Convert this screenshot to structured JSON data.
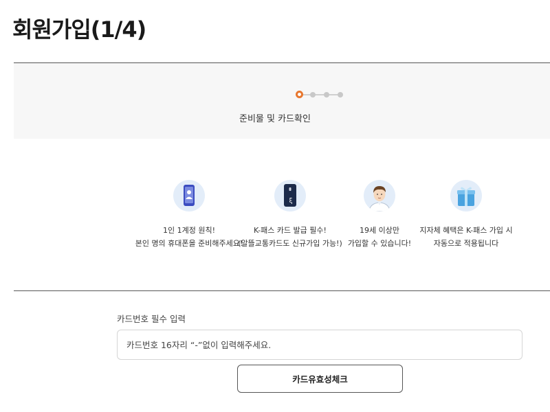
{
  "page": {
    "title": "회원가입(1/4)"
  },
  "stepper": {
    "total_steps": 4,
    "current_step": 1,
    "current_label": "준비물 및 카드확인",
    "accent_color": "#e8772e"
  },
  "features": [
    {
      "icon": "smartphone-user-icon",
      "line1": "1인 1계정 원칙!",
      "line2": "본인 명의 휴대폰을 준비해주세요!"
    },
    {
      "icon": "kpass-card-icon",
      "line1": "K-패스 카드 발급 필수!",
      "line2": "(알뜰교통카드도 신규가입 가능!)"
    },
    {
      "icon": "adult-person-icon",
      "line1": "19세 이상만",
      "line2": "가입할 수 있습니다!"
    },
    {
      "icon": "gift-box-icon",
      "line1": "지자체 혜택은 K-패스 가입 시",
      "line2": "자동으로 적용됩니다"
    }
  ],
  "card_form": {
    "label": "카드번호 필수 입력",
    "placeholder": "카드번호 16자리 “-”없이 입력해주세요.",
    "value": "",
    "check_button_label": "카드유효성체크"
  }
}
